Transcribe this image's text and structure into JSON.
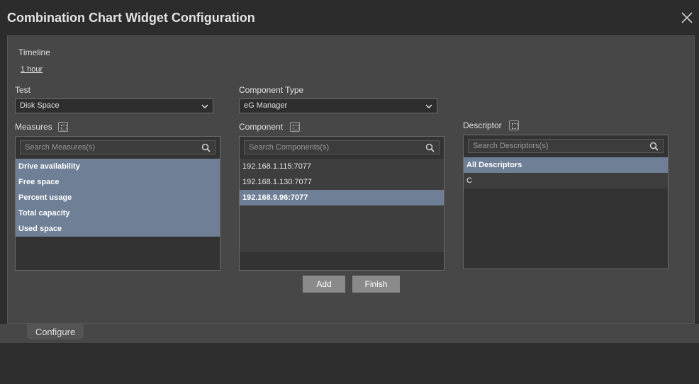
{
  "window": {
    "title": "Combination Chart Widget Configuration"
  },
  "timeline": {
    "label": "Timeline",
    "value": "1 hour"
  },
  "test": {
    "label": "Test",
    "selected": "Disk Space"
  },
  "component_type": {
    "label": "Component Type",
    "selected": "eG Manager"
  },
  "measures": {
    "label": "Measures",
    "search_placeholder": "Search Measures(s)",
    "items": [
      "Drive availability",
      "Free space",
      "Percent usage",
      "Total capacity",
      "Used space"
    ]
  },
  "component": {
    "label": "Component",
    "search_placeholder": "Search Components(s)",
    "items": [
      "192.168.1.115:7077",
      "192.168.1.130:7077",
      "192.168.9.96:7077"
    ]
  },
  "descriptor": {
    "label": "Descriptor",
    "search_placeholder": "Search Descriptors(s)",
    "items": [
      "All Descriptors",
      "C"
    ]
  },
  "buttons": {
    "add": "Add",
    "finish": "Finish"
  },
  "tabs": {
    "configure": "Configure"
  }
}
